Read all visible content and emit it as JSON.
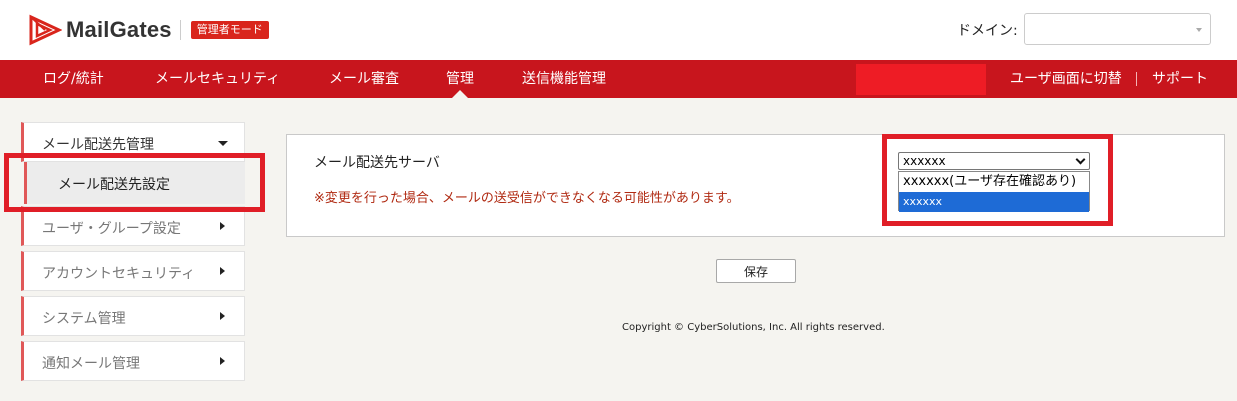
{
  "header": {
    "logo_text": "MailGates",
    "mode_badge": "管理者モード",
    "domain_label": "ドメイン:",
    "domain_value": ""
  },
  "nav": {
    "items": [
      "ログ/統計",
      "メールセキュリティ",
      "メール審査",
      "管理",
      "送信機能管理"
    ],
    "active_index": 3,
    "switch_user_label": "ユーザ画面に切替",
    "separator": "|",
    "support_label": "サポート"
  },
  "sidebar": {
    "items": [
      {
        "label": "メール配送先管理",
        "expanded": true
      },
      {
        "label": "ユーザ・グループ設定",
        "expanded": false
      },
      {
        "label": "アカウントセキュリティ",
        "expanded": false
      },
      {
        "label": "システム管理",
        "expanded": false
      },
      {
        "label": "通知メール管理",
        "expanded": false
      }
    ],
    "sub_item": "メール配送先設定"
  },
  "main": {
    "server_label": "メール配送先サーバ",
    "warning": "※変更を行った場合、メールの送受信ができなくなる可能性があります。",
    "select_value": "xxxxxx",
    "options": [
      "xxxxxx(ユーザ存在確認あり)",
      "xxxxxx"
    ],
    "highlighted_option_index": 1,
    "save_label": "保存"
  },
  "footer": {
    "copyright": "Copyright © CyberSolutions, Inc. All rights reserved."
  },
  "colors": {
    "brand_red": "#c8151d",
    "highlight_red": "#e01e27",
    "selected_blue": "#1e6bd6",
    "warning_text": "#b02a12",
    "page_bg": "#f5f4f0"
  }
}
